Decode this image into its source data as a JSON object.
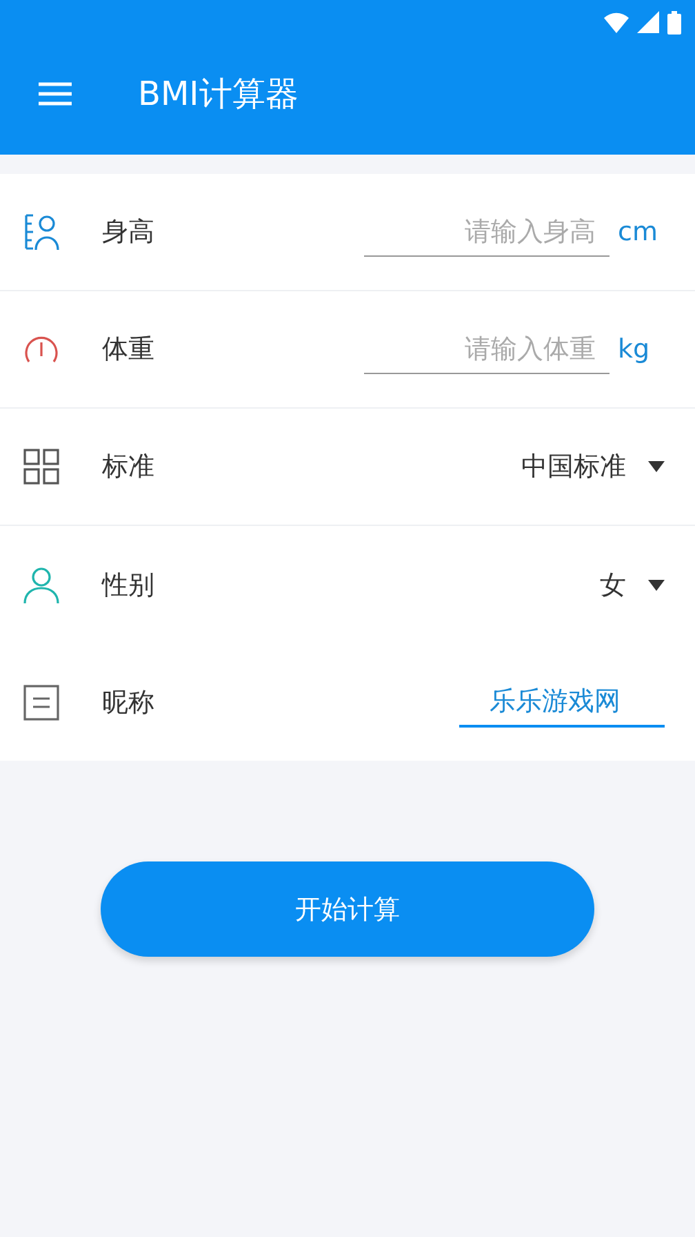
{
  "app_bar": {
    "title": "BMI计算器"
  },
  "form": {
    "rows": [
      {
        "kind": "input",
        "label": "身高",
        "placeholder": "请输入身高",
        "unit": "cm",
        "focused": false
      },
      {
        "kind": "input",
        "label": "体重",
        "placeholder": "请输入体重",
        "unit": "kg",
        "focused": false
      },
      {
        "kind": "select",
        "label": "标准",
        "value": "中国标准"
      },
      {
        "kind": "select",
        "label": "性别",
        "value": "女"
      },
      {
        "kind": "input",
        "label": "昵称",
        "value": "乐乐游戏网",
        "focused": true
      }
    ]
  },
  "button": {
    "label": "开始计算"
  }
}
